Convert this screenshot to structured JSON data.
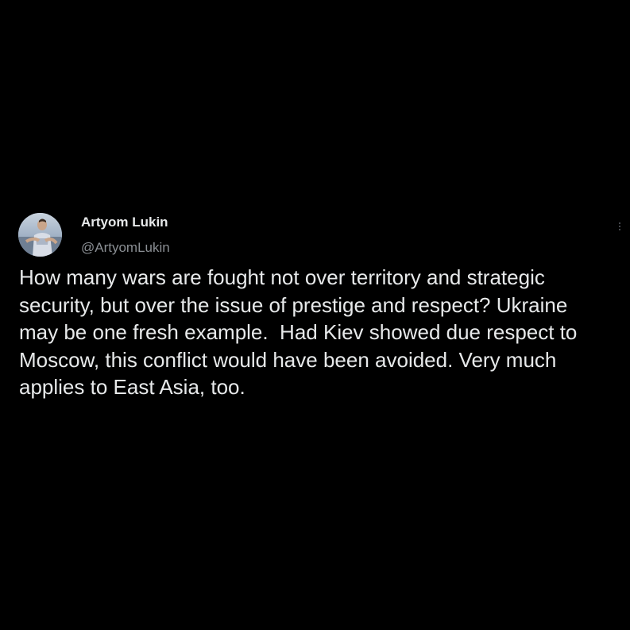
{
  "author": {
    "display_name": "Artyom Lukin",
    "handle": "@ArtyomLukin",
    "avatar_icon": "profile-photo"
  },
  "tweet": {
    "lines": [
      "How many wars are fought not over territory and strategic",
      "security, but over the issue of prestige and respect? Ukraine",
      "may be one fresh example.  Had Kiev showed due respect to",
      "Moscow, this conflict would have been avoided. Very much",
      "applies to East Asia, too."
    ]
  },
  "more_icon": "vertical-ellipsis-icon",
  "colors": {
    "background": "#000000",
    "text_primary": "#e7e9ea",
    "text_secondary": "#8b8f94"
  }
}
